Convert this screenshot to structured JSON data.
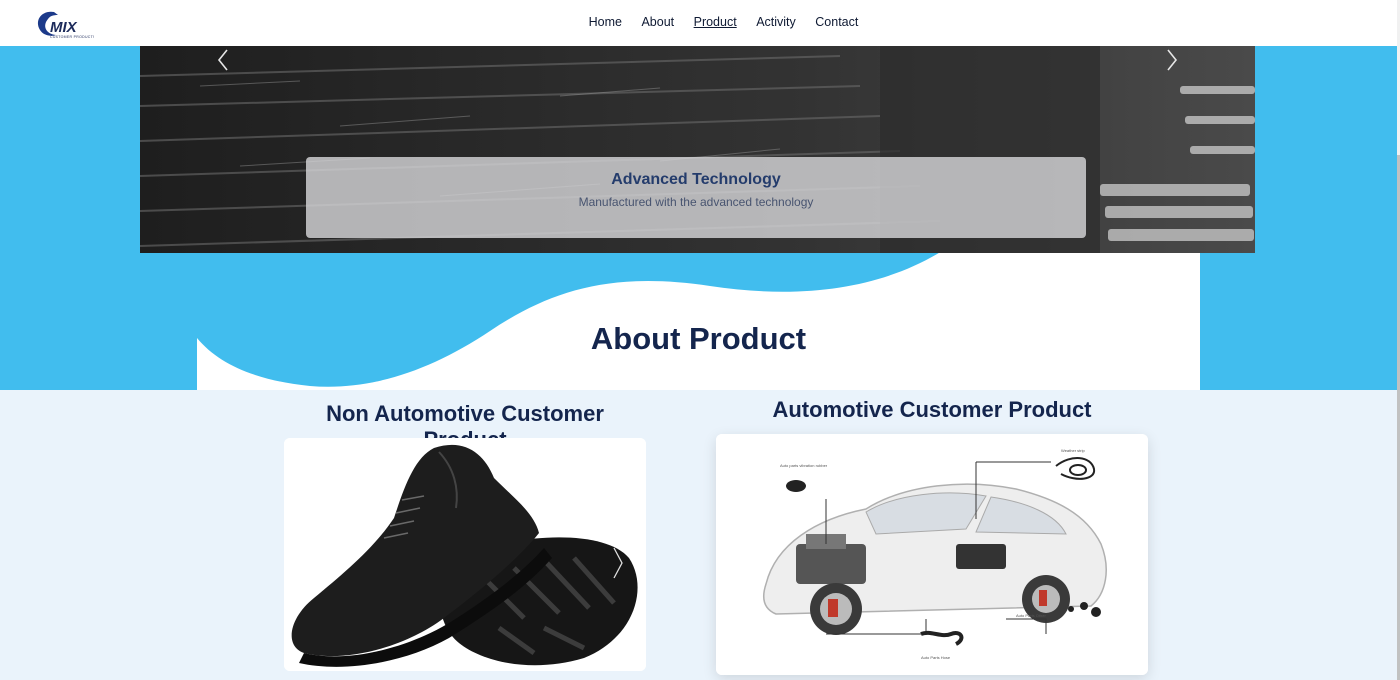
{
  "brand": {
    "name": "EMIX",
    "tagline": "CUSTOMER PRODUCTS"
  },
  "nav": {
    "items": [
      {
        "label": "Home",
        "active": false
      },
      {
        "label": "About",
        "active": false
      },
      {
        "label": "Product",
        "active": true
      },
      {
        "label": "Activity",
        "active": false
      },
      {
        "label": "Contact",
        "active": false
      }
    ]
  },
  "hero": {
    "caption_title": "Advanced Technology",
    "caption_subtitle": "Manufactured with the advanced technology",
    "prev_icon": "chevron-left-icon",
    "next_icon": "chevron-right-icon"
  },
  "section": {
    "title": "About Product"
  },
  "products": [
    {
      "title": "Non Automotive Customer Product",
      "image": "safety-shoes-image"
    },
    {
      "title": "Automotive Customer Product",
      "image": "car-parts-diagram-image"
    }
  ],
  "colors": {
    "accent_blue": "#41bdee",
    "heading_navy": "#14254d",
    "page_background": "#eaf3fb"
  }
}
